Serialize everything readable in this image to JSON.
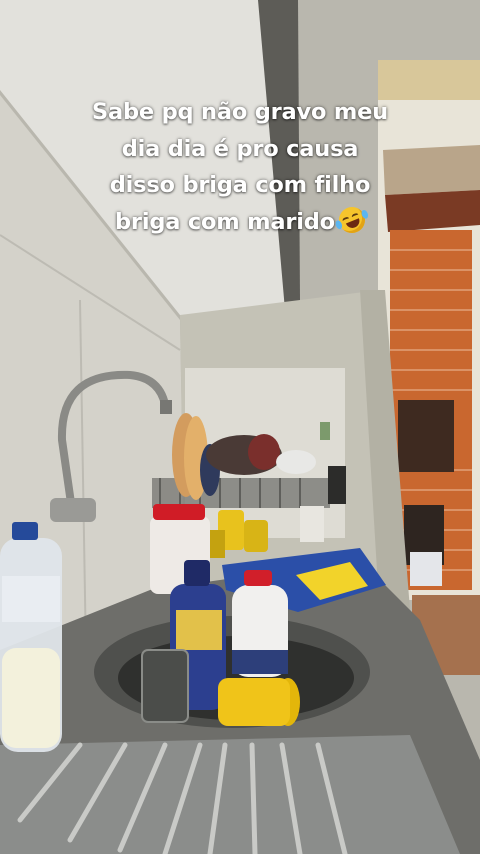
{
  "caption": {
    "lines": [
      "Sabe pq não gravo meu",
      "dia dia é pro causa",
      "disso briga com filho",
      "briga com marido"
    ],
    "emoji": "rolling-on-floor-laughing-emoji"
  },
  "colors": {
    "wall": "#c9c6bb",
    "counter": "#6e6e6a",
    "brick": "#c9672f",
    "sink_steel": "#8b8d8b",
    "caption_text": "#ffffff"
  }
}
